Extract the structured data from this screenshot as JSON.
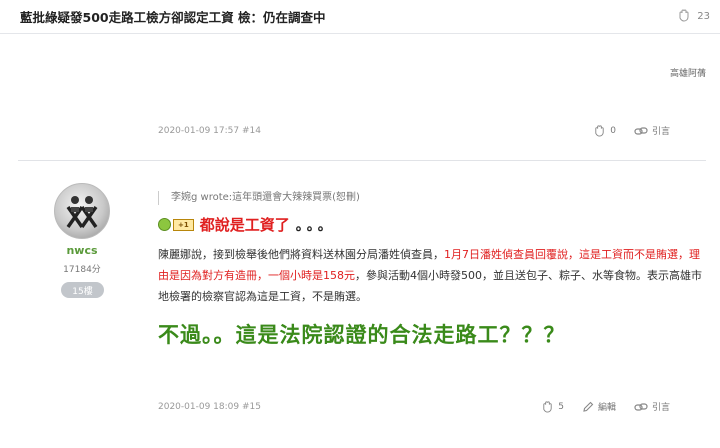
{
  "thread": {
    "title": "藍批綠疑發500走路工檢方卻認定工資 檢：仍在調查中",
    "gp_count": "23"
  },
  "post14": {
    "signature": "高雄阿蒨",
    "timestamp": "2020-01-09 17:57 #14",
    "gp_count": "0",
    "quote_label": "引言"
  },
  "post15": {
    "username": "nwcs",
    "points": "17184分",
    "floor": "15樓",
    "quote_ref": "李婉g wrote:這年頭還會大辣辣買票(恕刪)",
    "emoji_tag": "+1",
    "headline": "都說是工資了",
    "headline_dots": "。。。",
    "body_a": "陳麗娜說，接到檢舉後他們將資料送林園分局潘姓偵查員，",
    "body_red": "1月7日潘姓偵查員回覆說，這是工資而不是賄選，理由是因為對方有造冊，一個小時是158元",
    "body_b": "，參與活動4個小時發500，並且送包子、粽子、水等食物。表示高雄市地檢署的檢察官認為這是工資，不是賄選。",
    "green_text": "不過。。這是法院認證的合法走路工？？？",
    "timestamp": "2020-01-09 18:09 #15",
    "gp_count": "5",
    "edit_label": "編輯",
    "quote_label": "引言"
  },
  "colors": {
    "red": "#e02020",
    "green": "#3a8a1a",
    "username_green": "#5a9a3a"
  }
}
